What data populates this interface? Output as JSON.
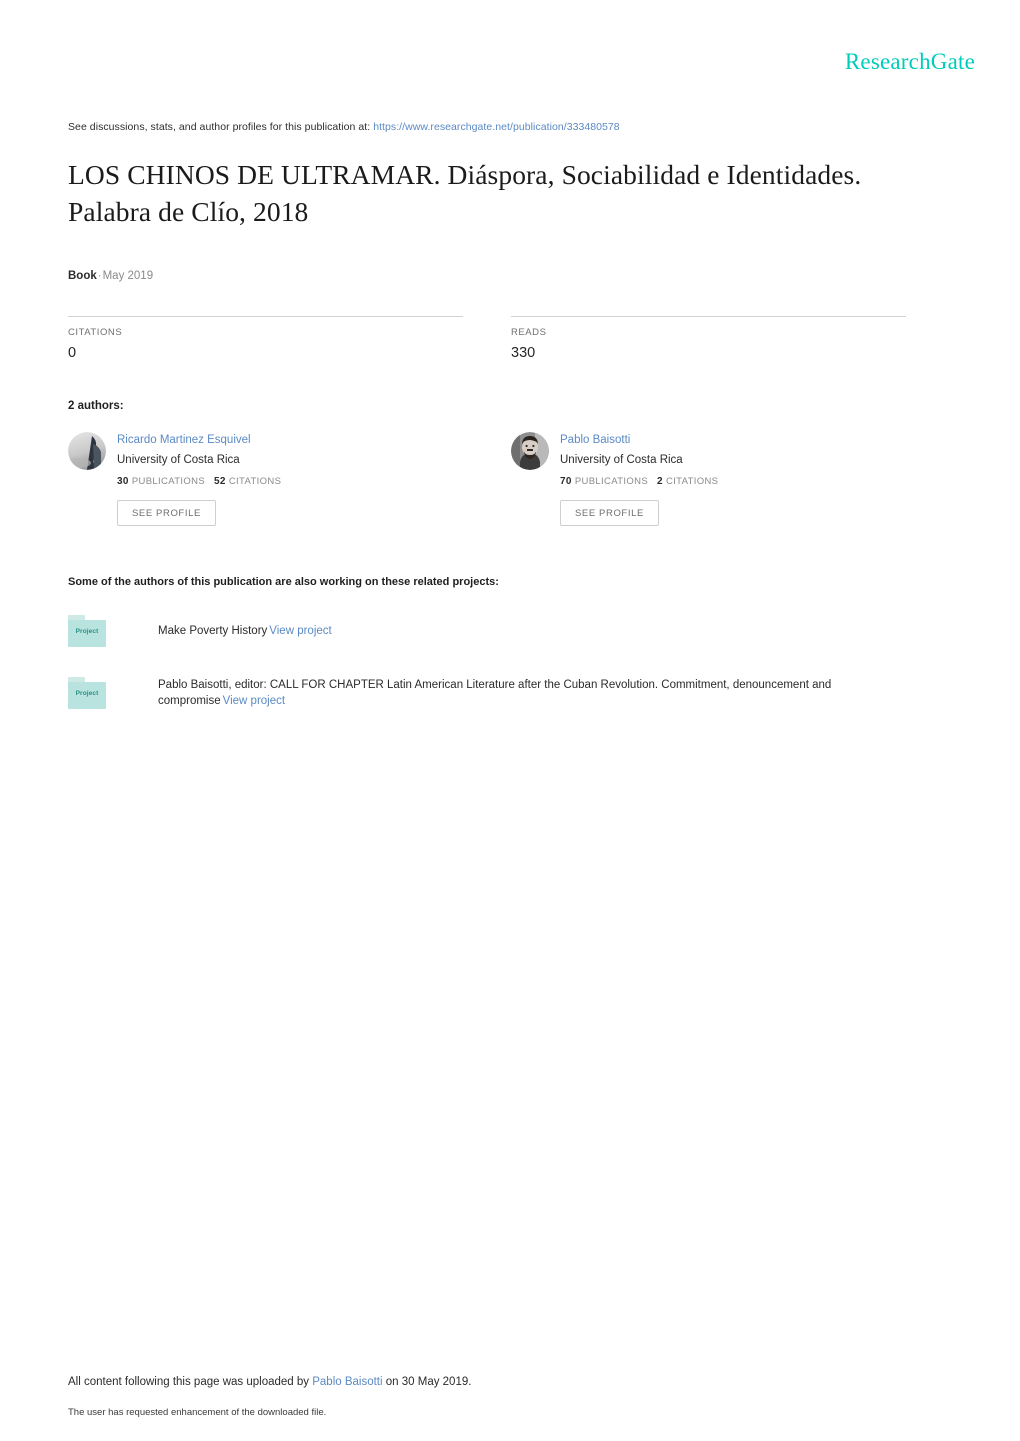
{
  "header": {
    "logo_text": "ResearchGate",
    "logo_color": "#00ccbb"
  },
  "discussion": {
    "prefix": "See discussions, stats, and author profiles for this publication at:",
    "url": "https://www.researchgate.net/publication/333480578"
  },
  "publication": {
    "title": "LOS CHINOS DE ULTRAMAR. Diáspora, Sociabilidad e Identidades. Palabra de Clío, 2018",
    "type": "Book",
    "separator": "·",
    "date": "May 2019"
  },
  "stats": [
    {
      "label": "CITATIONS",
      "value": "0"
    },
    {
      "label": "READS",
      "value": "330"
    }
  ],
  "authors_section": {
    "heading": "2 authors:",
    "see_profile_label": "SEE PROFILE",
    "authors": [
      {
        "name": "Ricardo Martinez Esquivel",
        "affiliation": "University of Costa Rica",
        "publications_count": "30",
        "publications_label": "PUBLICATIONS",
        "citations_count": "52",
        "citations_label": "CITATIONS"
      },
      {
        "name": "Pablo Baisotti",
        "affiliation": "University of Costa Rica",
        "publications_count": "70",
        "publications_label": "PUBLICATIONS",
        "citations_count": "2",
        "citations_label": "CITATIONS"
      }
    ]
  },
  "projects_section": {
    "heading": "Some of the authors of this publication are also working on these related projects:",
    "folder_icon_label": "Project",
    "view_project_label": "View project",
    "projects": [
      {
        "title": "Make Poverty History"
      },
      {
        "title": "Pablo Baisotti, editor: CALL FOR CHAPTER Latin American Literature after the Cuban Revolution. Commitment, denouncement and compromise"
      }
    ]
  },
  "footer": {
    "upload_prefix": "All content following this page was uploaded by",
    "uploader": "Pablo Baisotti",
    "upload_suffix": "on 30 May 2019.",
    "enhancement_note": "The user has requested enhancement of the downloaded file."
  }
}
